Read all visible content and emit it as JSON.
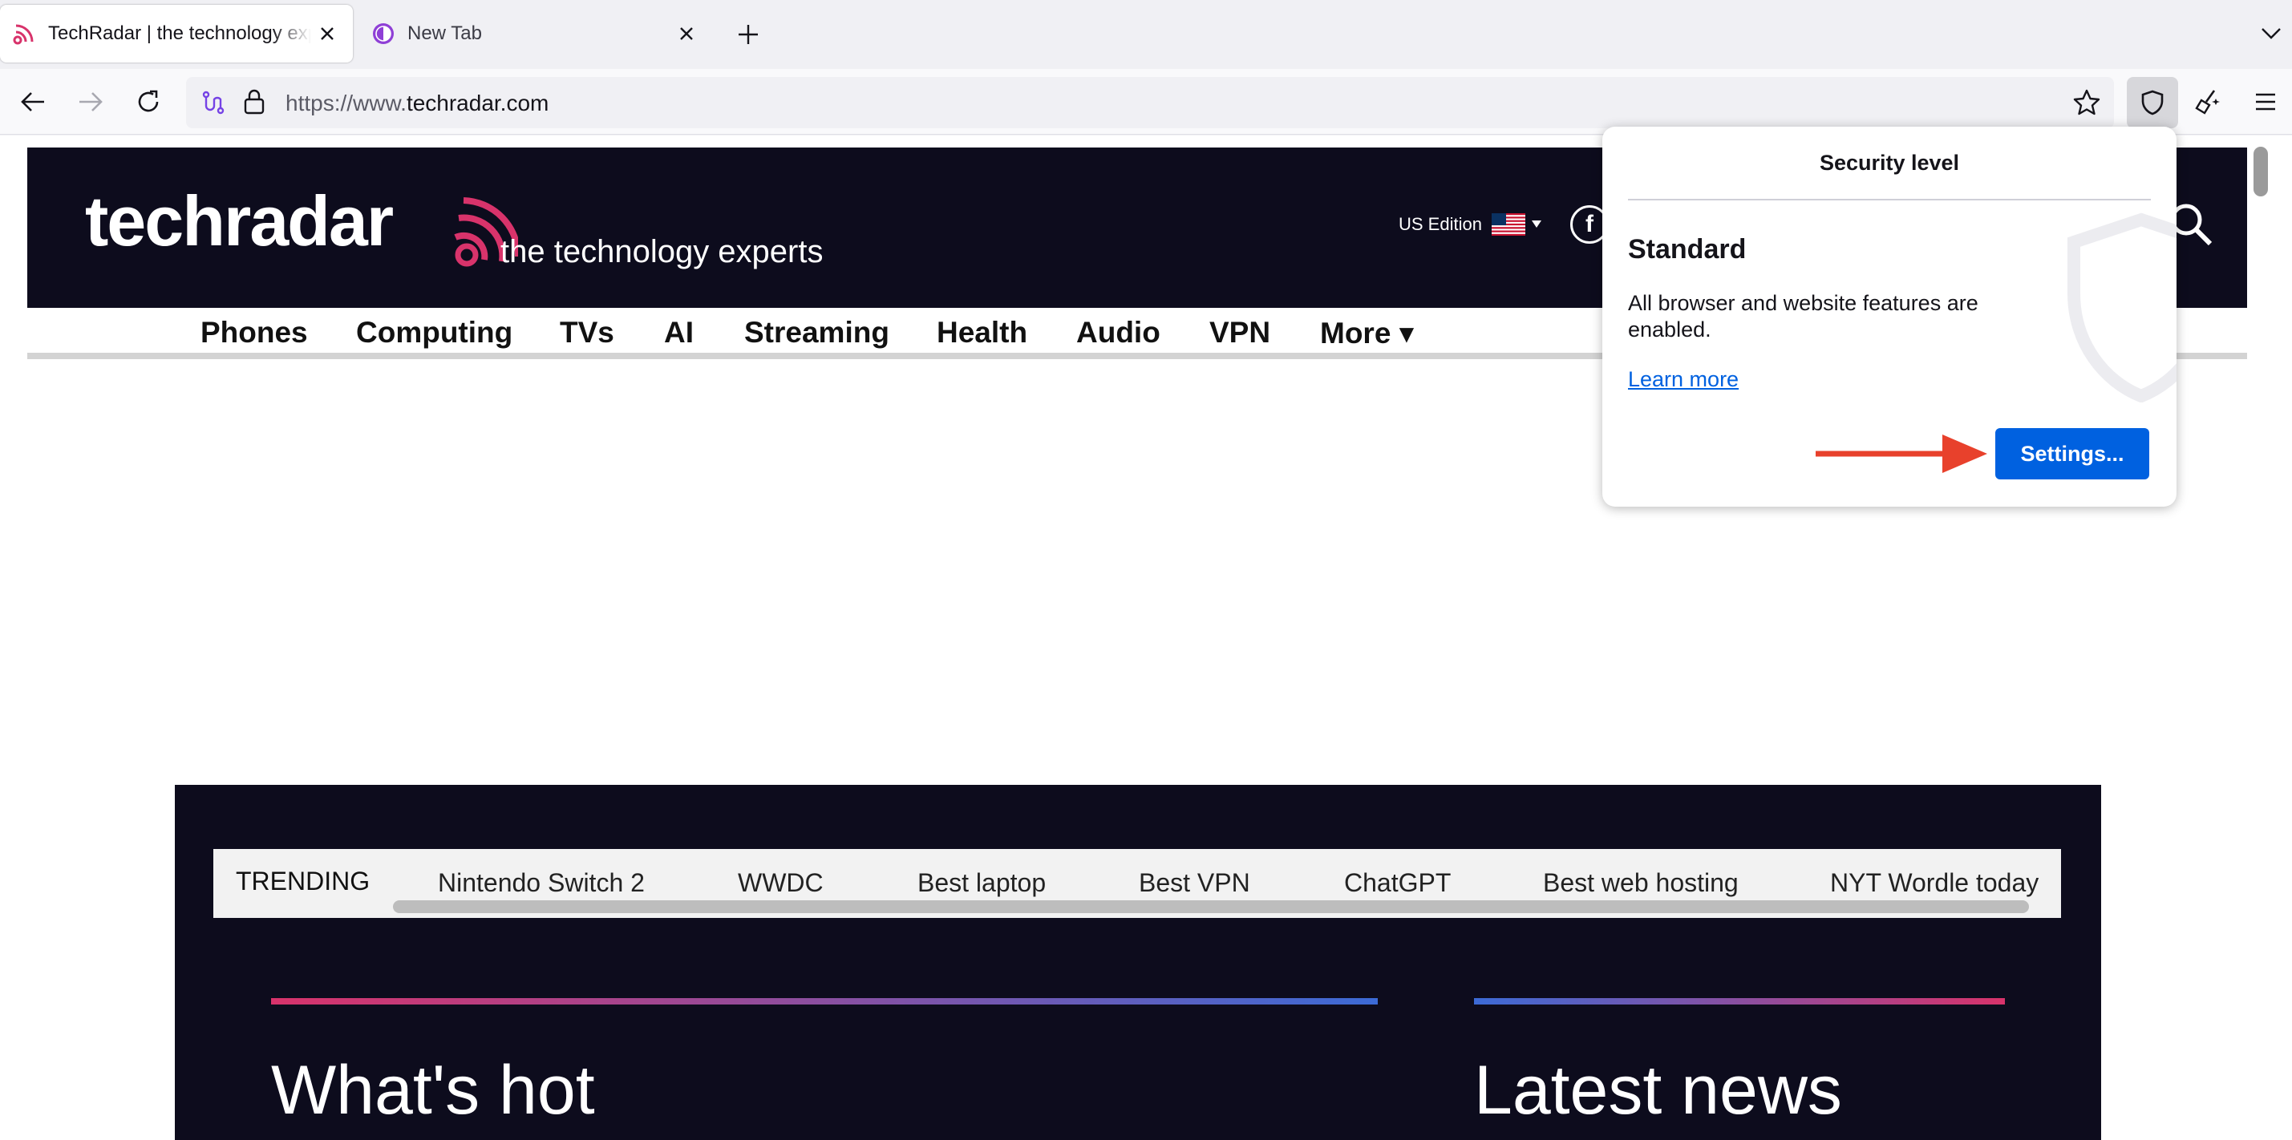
{
  "tabs": [
    {
      "title": "TechRadar | the technology experts",
      "icon": "rss-icon"
    },
    {
      "title": "New Tab",
      "icon": "tor-onion-icon"
    }
  ],
  "navbar": {
    "url_prefix": "https://www.",
    "url_host": "techradar.com"
  },
  "site": {
    "logo_text": "techradar",
    "tagline": "the technology experts",
    "edition": "US Edition",
    "facebook_glyph": "f",
    "nav": [
      "Phones",
      "Computing",
      "TVs",
      "AI",
      "Streaming",
      "Health",
      "Audio",
      "VPN",
      "More ▾"
    ],
    "trending_label": "TRENDING",
    "trending": [
      "Nintendo Switch 2",
      "WWDC",
      "Best laptop",
      "Best VPN",
      "ChatGPT",
      "Best web hosting",
      "NYT Wordle today"
    ],
    "sections": {
      "hot": "What's hot",
      "news": "Latest news"
    }
  },
  "popup": {
    "title": "Security level",
    "level": "Standard",
    "description": "All browser and website features are enabled.",
    "learn_more": "Learn more",
    "settings_label": "Settings..."
  },
  "colors": {
    "brand_dark": "#0d0c1d",
    "brand_pink": "#d8336b",
    "accent_blue": "#0061e0",
    "annotation_red": "#e8412c"
  }
}
